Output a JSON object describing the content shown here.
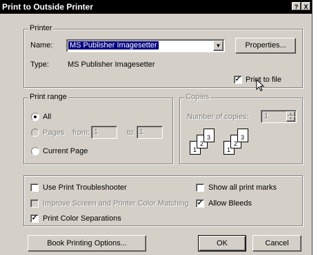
{
  "window": {
    "title": "Print to Outside Printer",
    "help_btn": "?",
    "close_btn": "X"
  },
  "printer": {
    "group_label": "Printer",
    "name_label": "Name:",
    "name_value": "MS Publisher Imagesetter",
    "properties_button": "Properties...",
    "type_label": "Type:",
    "type_value": "MS Publisher Imagesetter",
    "print_to_file_label": "Print to file",
    "print_to_file_checked": true
  },
  "print_range": {
    "group_label": "Print range",
    "all_label": "All",
    "pages_label": "Pages",
    "from_label": "from:",
    "from_value": "1",
    "to_label": "to:",
    "to_value": "1",
    "current_page_label": "Current Page",
    "selected": "All"
  },
  "copies": {
    "group_label": "Copies",
    "number_label": "Number of copies:",
    "number_value": "1",
    "collate_icon": "collate-pages-icon",
    "page_numbers": [
      "1",
      "2",
      "3"
    ]
  },
  "options": {
    "use_troubleshooter": "Use Print Troubleshooter",
    "improve_matching": "Improve Screen and Printer Color Matching",
    "color_separations": "Print Color Separations",
    "show_marks": "Show all print marks",
    "allow_bleeds": "Allow Bleeds"
  },
  "buttons": {
    "book_printing": "Book Printing Options...",
    "ok": "OK",
    "cancel": "Cancel"
  }
}
